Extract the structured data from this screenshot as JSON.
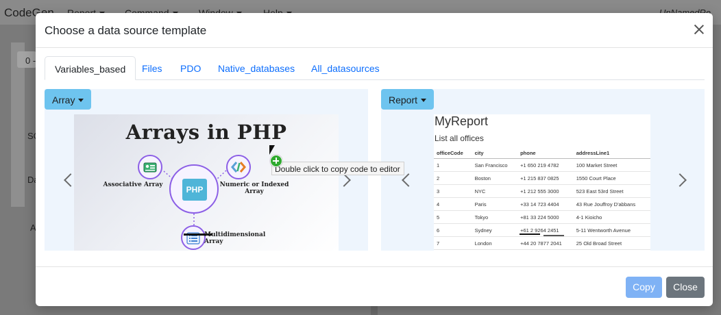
{
  "app": {
    "brand": "CodeGen",
    "menus": [
      "Report",
      "Command",
      "Window",
      "Help"
    ],
    "file": "UnNamedRe",
    "bg_box": "0 -",
    "bg_texts": [
      "SC",
      "Da",
      "A"
    ]
  },
  "modal": {
    "title": "Choose a data source template",
    "tabs": [
      {
        "label": "Variables_based",
        "active": true
      },
      {
        "label": "Files",
        "active": false
      },
      {
        "label": "PDO",
        "active": false
      },
      {
        "label": "Native_databases",
        "active": false
      },
      {
        "label": "All_datasources",
        "active": false
      }
    ],
    "left_panel": {
      "dropdown": "Array",
      "slide": {
        "title": "Arrays in PHP",
        "core": "PHP",
        "labels": {
          "associative": "Associative Array",
          "numeric": "Numeric or Indexed Array",
          "multidimensional": "Multidimensional Array"
        }
      }
    },
    "right_panel": {
      "dropdown": "Report",
      "slide": {
        "title": "MyReport",
        "subtitle": "List all offices",
        "columns": [
          "officeCode",
          "city",
          "phone",
          "addressLine1"
        ],
        "rows": [
          [
            "1",
            "San Francisco",
            "+1 650 219 4782",
            "100 Market Street"
          ],
          [
            "2",
            "Boston",
            "+1 215 837 0825",
            "1550 Court Place"
          ],
          [
            "3",
            "NYC",
            "+1 212 555 3000",
            "523 East 53rd Street"
          ],
          [
            "4",
            "Paris",
            "+33 14 723 4404",
            "43 Rue Jouffroy D'abbans"
          ],
          [
            "5",
            "Tokyo",
            "+81 33 224 5000",
            "4-1 Kioicho"
          ],
          [
            "6",
            "Sydney",
            "+61 2 9264 2451",
            "5-11 Wentworth Avenue"
          ],
          [
            "7",
            "London",
            "+44 20 7877 2041",
            "25 Old Broad Street"
          ]
        ]
      }
    },
    "tooltip": "Double click to copy code to editor",
    "footer": {
      "copy_label": "Copy",
      "close_label": "Close"
    }
  }
}
